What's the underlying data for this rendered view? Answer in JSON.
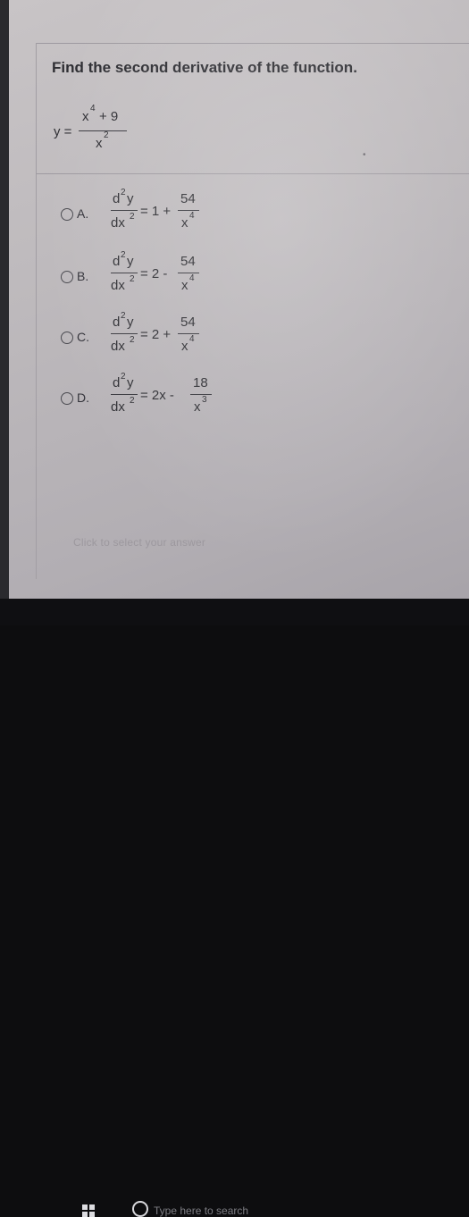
{
  "question": {
    "text": "Find the second derivative of the function."
  },
  "function": {
    "lhs": "y =",
    "num": "x",
    "num_exp": "4",
    "num_rest": "+ 9",
    "den": "x",
    "den_exp": "2"
  },
  "options": [
    {
      "letter": "A.",
      "top_d": "d",
      "top_exp": "2",
      "top_y": "y",
      "bot_dx": "dx",
      "bot_exp": "2",
      "eq": "= 1 +",
      "num": "54",
      "den": "x",
      "den_exp": "4"
    },
    {
      "letter": "B.",
      "top_d": "d",
      "top_exp": "2",
      "top_y": "y",
      "bot_dx": "dx",
      "bot_exp": "2",
      "eq": "= 2 -",
      "num": "54",
      "den": "x",
      "den_exp": "4"
    },
    {
      "letter": "C.",
      "top_d": "d",
      "top_exp": "2",
      "top_y": "y",
      "bot_dx": "dx",
      "bot_exp": "2",
      "eq": "= 2 +",
      "num": "54",
      "den": "x",
      "den_exp": "4"
    },
    {
      "letter": "D.",
      "top_d": "d",
      "top_exp": "2",
      "top_y": "y",
      "bot_dx": "dx",
      "bot_exp": "2",
      "eq": "= 2x -",
      "num": "18",
      "den": "x",
      "den_exp": "3"
    }
  ],
  "footer": {
    "prompt": "Click to select your answer"
  },
  "taskbar": {
    "search_placeholder": "Type here to search",
    "start_icon": "windows-logo-icon",
    "search_icon": "search-icon"
  }
}
